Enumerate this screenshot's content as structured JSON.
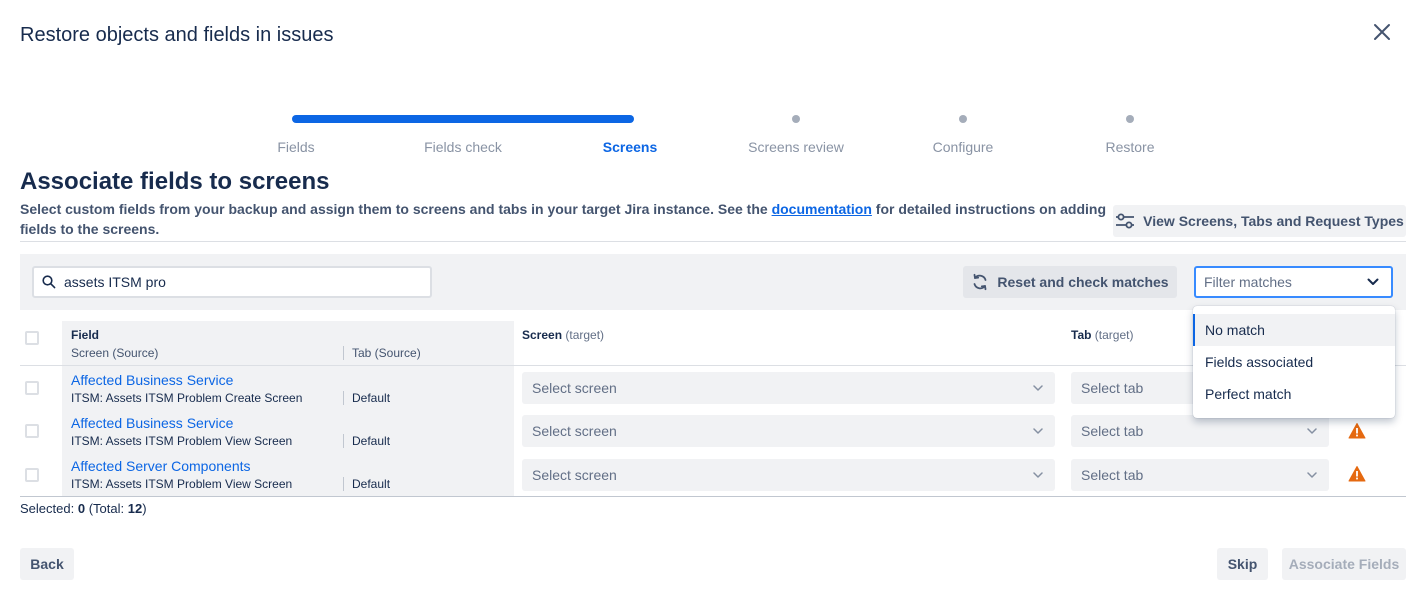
{
  "modal": {
    "title": "Restore objects and fields in issues",
    "close_icon": "close-icon"
  },
  "steps": [
    {
      "label": "Fields",
      "state": "complete"
    },
    {
      "label": "Fields check",
      "state": "complete"
    },
    {
      "label": "Screens",
      "state": "current"
    },
    {
      "label": "Screens review",
      "state": "todo"
    },
    {
      "label": "Configure",
      "state": "todo"
    },
    {
      "label": "Restore",
      "state": "todo"
    }
  ],
  "section": {
    "title": "Associate fields to screens",
    "desc_before": "Select custom fields from your backup and assign them to screens and tabs in your target Jira instance. See the ",
    "desc_link": "documentation",
    "desc_after": " for detailed instructions on adding fields to the screens."
  },
  "toolbar": {
    "view_button": "View Screens, Tabs and Request Types",
    "view_icon": "sliders-icon",
    "search_value": "assets ITSM pro",
    "search_icon": "search-icon",
    "reset_button": "Reset and check matches",
    "reset_icon": "refresh-icon",
    "filter_placeholder": "Filter matches",
    "filter_icon": "chevron-down-icon"
  },
  "filter_menu": {
    "options": [
      "No match",
      "Fields associated",
      "Perfect match"
    ],
    "focused_index": 0
  },
  "table": {
    "headers": {
      "field": "Field",
      "screen_source": "Screen (Source)",
      "tab_source": "Tab (Source)",
      "screen_target": "Screen",
      "screen_target_suffix": "(target)",
      "tab_target": "Tab",
      "tab_target_suffix": "(target)"
    },
    "rows": [
      {
        "field": "Affected Business Service",
        "source_screen": "ITSM: Assets ITSM Problem Create Screen",
        "source_tab": "Default",
        "screen_placeholder": "Select screen",
        "tab_placeholder": "Select tab",
        "warning": false
      },
      {
        "field": "Affected Business Service",
        "source_screen": "ITSM: Assets ITSM Problem View Screen",
        "source_tab": "Default",
        "screen_placeholder": "Select screen",
        "tab_placeholder": "Select tab",
        "warning": true
      },
      {
        "field": "Affected Server Components",
        "source_screen": "ITSM: Assets ITSM Problem View Screen",
        "source_tab": "Default",
        "screen_placeholder": "Select screen",
        "tab_placeholder": "Select tab",
        "warning": true
      }
    ],
    "warning_color": "#e56910"
  },
  "selection": {
    "label": "Selected:",
    "count": "0",
    "total_prefix": "(Total:",
    "total": "12",
    "total_suffix": ")"
  },
  "footer": {
    "back": "Back",
    "skip": "Skip",
    "associate": "Associate Fields"
  },
  "colors": {
    "accent": "#0c66e4",
    "text": "#172b4d",
    "subtle_bg": "#f1f2f4"
  }
}
